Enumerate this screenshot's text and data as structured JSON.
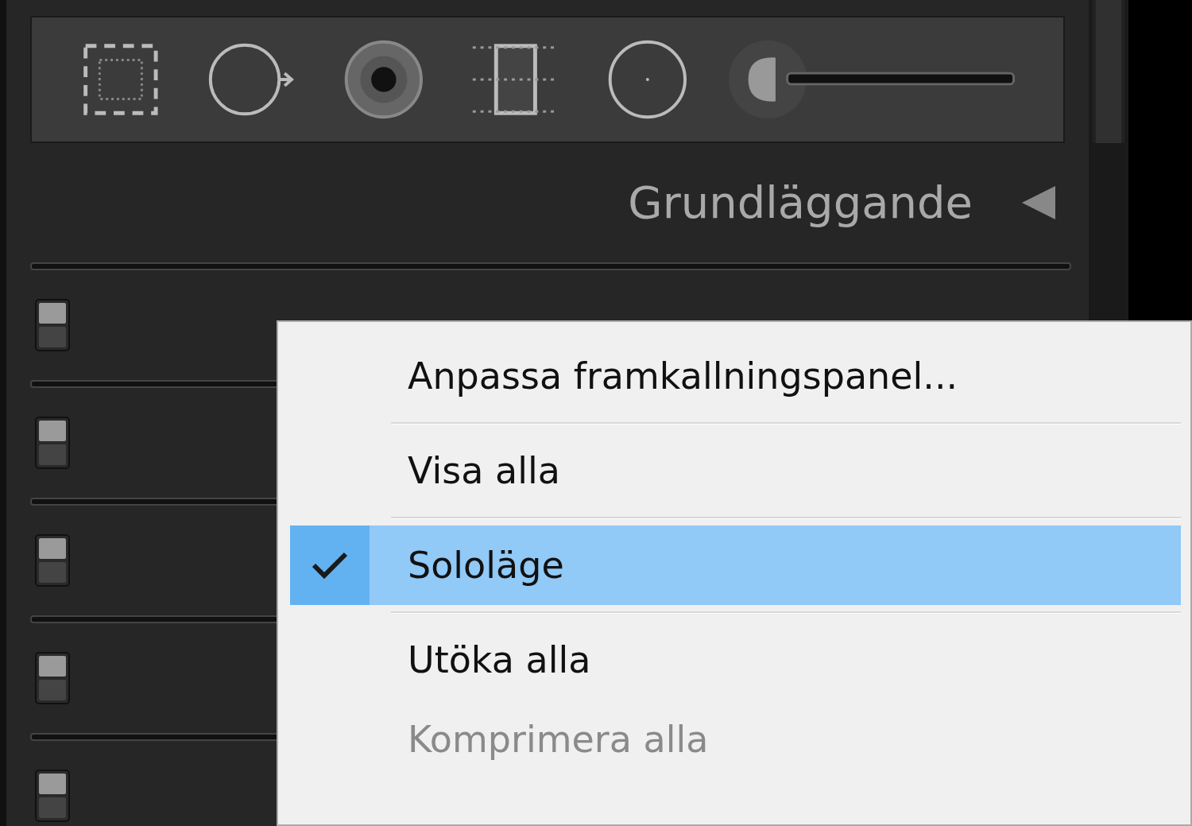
{
  "tools": [
    {
      "kind": "crop"
    },
    {
      "kind": "spot"
    },
    {
      "kind": "redeye"
    },
    {
      "kind": "graduated"
    },
    {
      "kind": "radial"
    },
    {
      "kind": "brush"
    }
  ],
  "panel": {
    "title": "Grundläggande"
  },
  "rows": [
    {
      "on": true
    },
    {
      "on": true
    },
    {
      "on": true
    },
    {
      "on": true
    },
    {
      "on": true
    }
  ],
  "menu": {
    "items": [
      {
        "label": "Anpassa framkallningspanel...",
        "checked": false,
        "selected": false,
        "disabled": false,
        "separator_after": true
      },
      {
        "label": "Visa alla",
        "checked": false,
        "selected": false,
        "disabled": false,
        "separator_after": true
      },
      {
        "label": "Sololäge",
        "checked": true,
        "selected": true,
        "disabled": false,
        "separator_after": true
      },
      {
        "label": "Utöka alla",
        "checked": false,
        "selected": false,
        "disabled": false,
        "separator_after": false
      },
      {
        "label": "Komprimera alla",
        "checked": false,
        "selected": false,
        "disabled": true,
        "separator_after": false
      }
    ]
  }
}
